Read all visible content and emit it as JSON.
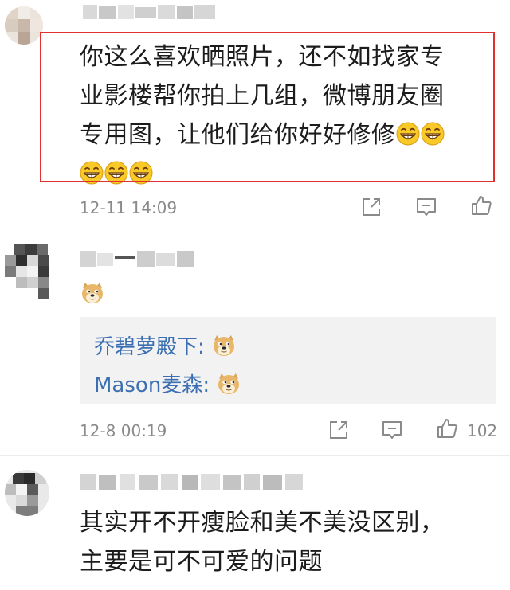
{
  "comments": [
    {
      "text_line1": "你这么喜欢晒照片，还不如找家专",
      "text_line2": "业影楼帮你拍上几组，微博朋友圈",
      "text_line3": "专用图，让他们给你好好修修",
      "emoji_name": "grinning-emoji",
      "time": "12-11 14:09",
      "likes": ""
    },
    {
      "emoji_name": "doge-emoji",
      "time": "12-8 00:19",
      "likes": "102",
      "replies": [
        {
          "name": "乔碧萝殿下",
          "colon": ":",
          "emoji_name": "doge-emoji"
        },
        {
          "name": "Mason麦森",
          "colon": ":",
          "emoji_name": "doge-emoji"
        }
      ]
    },
    {
      "text_line1": "其实开不开瘦脸和美不美没区别，",
      "text_line2": "主要是可不可爱的问题"
    }
  ],
  "actions": {
    "share_icon": "share-icon",
    "comment_icon": "comment-icon",
    "like_icon": "thumbs-up-icon"
  },
  "colors": {
    "highlight": "#e03030",
    "reply_name": "#3c6fb1",
    "meta": "#8a8a8a",
    "reply_bg": "#f2f2f2"
  }
}
